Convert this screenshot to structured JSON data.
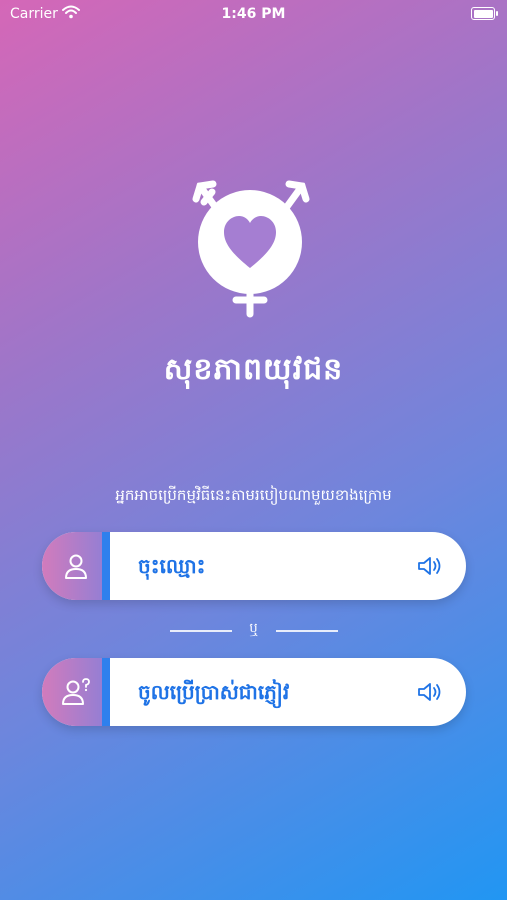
{
  "status_bar": {
    "carrier": "Carrier",
    "time": "1:46 PM"
  },
  "app": {
    "title": "សុខភាពយុវជន",
    "subtitle": "អ្នកអាចប្រើកម្មវិធីនេះតាមរបៀបណាមួយខាងក្រោម"
  },
  "options": [
    {
      "label": "ចុះឈ្មោះ",
      "icon": "user-icon"
    },
    {
      "label": "ចូលប្រើប្រាស់ជាភ្ញៀវ",
      "icon": "guest-user-icon"
    }
  ],
  "divider": {
    "text": "ឬ"
  },
  "colors": {
    "accent": "#1f73e6",
    "gradient_start": "#d567b7",
    "gradient_end": "#2196f3"
  }
}
